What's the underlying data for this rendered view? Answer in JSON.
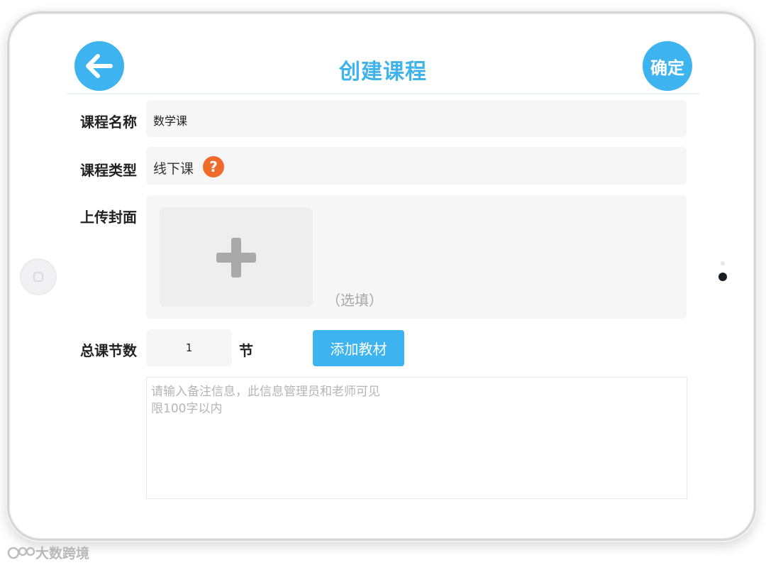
{
  "header": {
    "title": "创建课程",
    "confirm_label": "确定"
  },
  "form": {
    "course_name": {
      "label": "课程名称",
      "value": "数学课"
    },
    "course_type": {
      "label": "课程类型",
      "value": "线下课",
      "help_icon": "?"
    },
    "cover": {
      "label": "上传封面",
      "optional_hint": "（选填）"
    },
    "lessons": {
      "label": "总课节数",
      "value": "1",
      "unit": "节"
    },
    "add_material_label": "添加教材",
    "note": {
      "placeholder_line1": "请输入备注信息，此信息管理员和老师可见",
      "placeholder_line2": "限100字以内"
    }
  },
  "watermark": "大数跨境",
  "colors": {
    "accent": "#3db4ef",
    "title": "#40b3ec",
    "help": "#f06a2c",
    "field_bg": "#f6f6f6"
  },
  "icons": [
    "arrow-left-icon",
    "question-icon",
    "plus-icon"
  ]
}
